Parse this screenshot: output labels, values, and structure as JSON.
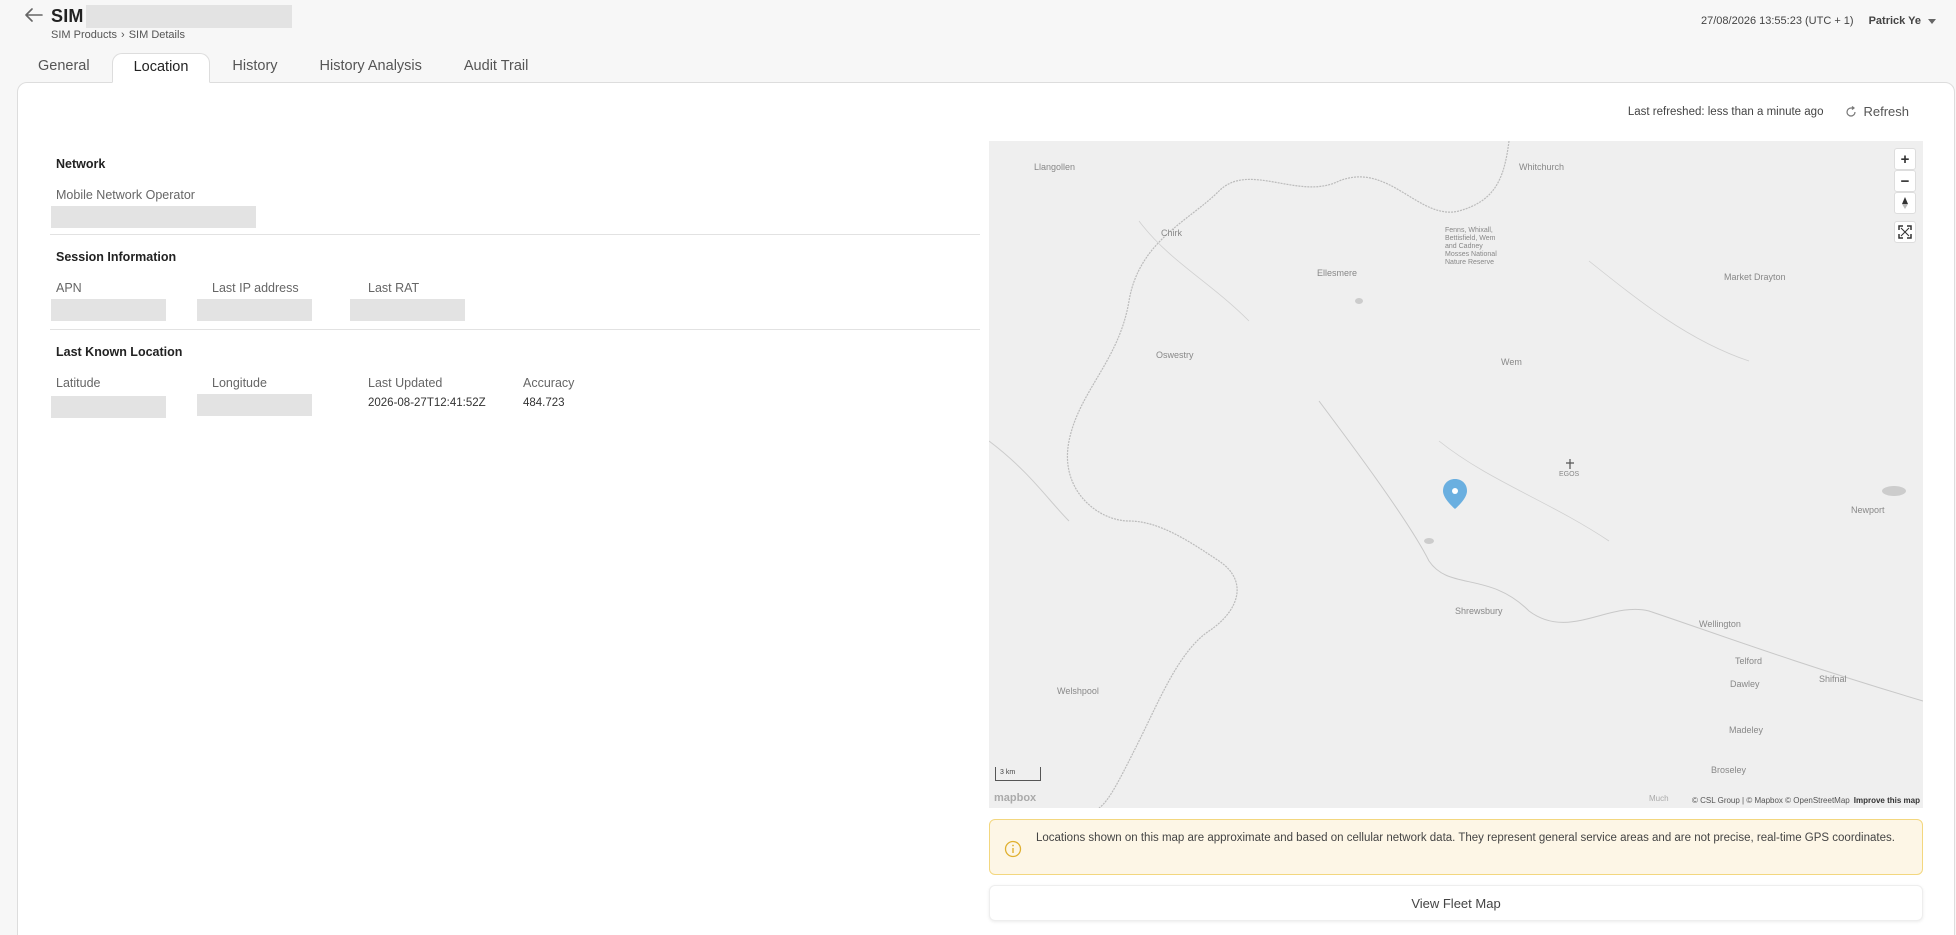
{
  "header": {
    "title": "SIM",
    "breadcrumb": [
      "SIM Products",
      "SIM Details"
    ],
    "breadcrumb_separator": "›",
    "datetime": "27/08/2026 13:55:23 (UTC + 1)",
    "user": "Patrick Ye"
  },
  "tabs": [
    {
      "label": "General"
    },
    {
      "label": "Location",
      "active": true
    },
    {
      "label": "History"
    },
    {
      "label": "History Analysis"
    },
    {
      "label": "Audit Trail"
    }
  ],
  "refresh": {
    "status": "Last refreshed: less than a minute ago",
    "button_label": "Refresh"
  },
  "network": {
    "title": "Network",
    "mno_label": "Mobile Network Operator"
  },
  "session": {
    "title": "Session Information",
    "apn_label": "APN",
    "ip_label": "Last IP address",
    "rat_label": "Last RAT"
  },
  "location": {
    "title": "Last Known Location",
    "lat_label": "Latitude",
    "lon_label": "Longitude",
    "updated_label": "Last Updated",
    "updated_value": "2026-08-27T12:41:52Z",
    "accuracy_label": "Accuracy",
    "accuracy_value": "484.723"
  },
  "map": {
    "places": [
      "Llangollen",
      "Whitchurch",
      "Chirk",
      "Fenns, Whixall, Bettisfield, Wem and Cadney Mosses National Nature Reserve",
      "Ellesmere",
      "Market Drayton",
      "Oswestry",
      "Wem",
      "EGOS",
      "Newport",
      "Shrewsbury",
      "Wellington",
      "Telford",
      "Dawley",
      "Shifnal",
      "Welshpool",
      "Madeley",
      "Broseley",
      "Much"
    ],
    "scale": "3 km",
    "logo": "mapbox",
    "attribution": "© CSL Group | © Mapbox © OpenStreetMap",
    "improve": "Improve this map",
    "zoom_in": "+",
    "zoom_out": "−",
    "marker_color": "#6aafe0"
  },
  "notice": {
    "text": "Locations shown on this map are approximate and based on cellular network data. They represent general service areas and are not precise, real-time GPS coordinates.",
    "icon": "info-icon"
  },
  "fleet_button": "View Fleet Map"
}
